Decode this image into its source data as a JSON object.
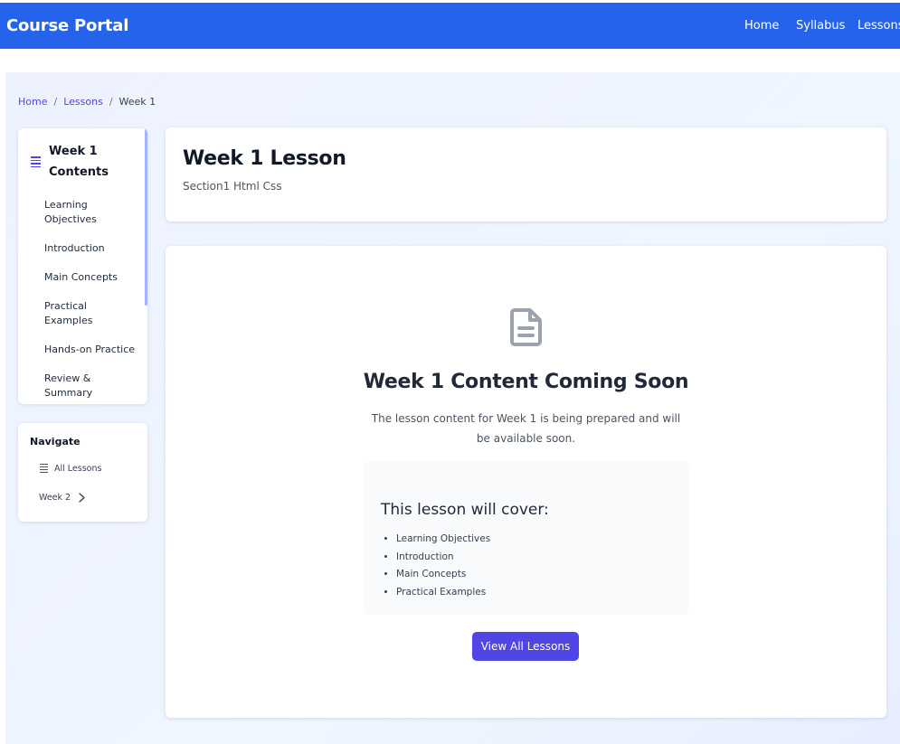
{
  "app": {
    "title": "Course Portal"
  },
  "nav": {
    "items": [
      "Home",
      "Syllabus",
      "Lessons"
    ]
  },
  "breadcrumb": {
    "items": [
      "Home",
      "Lessons",
      "Week 1"
    ],
    "separator": "/"
  },
  "toc": {
    "title": "Week 1 Contents",
    "items": [
      "Learning Objectives",
      "Introduction",
      "Main Concepts",
      "Practical Examples",
      "Hands-on Practice",
      "Review & Summary"
    ]
  },
  "navigate": {
    "title": "Navigate",
    "all_label": "All Lessons",
    "next_label": "Week 2"
  },
  "lesson": {
    "title": "Week 1 Lesson",
    "subtitle": "Section1 Html Css"
  },
  "placeholder": {
    "heading": "Week 1 Content Coming Soon",
    "description": "The lesson content for Week 1 is being prepared and will be available soon.",
    "cover_title": "This lesson will cover:",
    "cover_items": [
      "Learning Objectives",
      "Introduction",
      "Main Concepts",
      "Practical Examples"
    ],
    "button_label": "View All Lessons"
  },
  "colors": {
    "topbar": "#2563eb",
    "accent": "#4f46e5",
    "background": "#eef2ff"
  },
  "icons": {
    "toc": "list-icon",
    "document": "document-icon",
    "next": "chevron-right-icon"
  }
}
